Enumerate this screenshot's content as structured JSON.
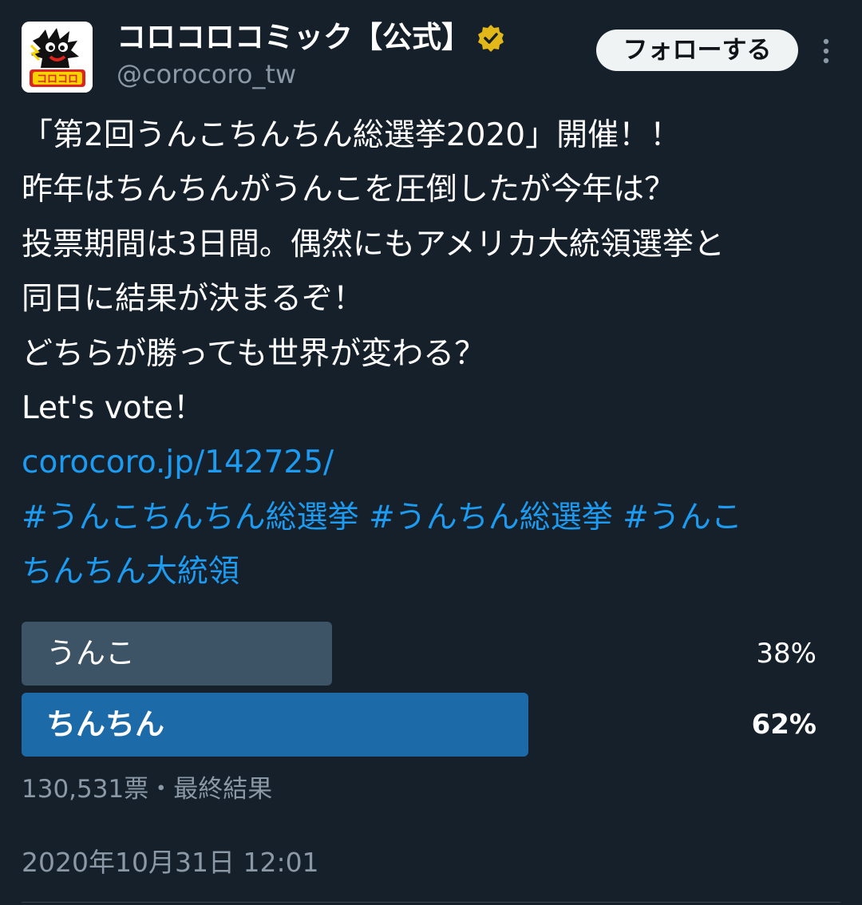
{
  "account": {
    "display_name": "コロコロコミック【公式】",
    "handle": "@corocoro_tw",
    "logo_text": "コロコロ"
  },
  "follow_button": {
    "label": "フォローする"
  },
  "tweet": {
    "lines": [
      "「第2回うんこちんちん総選挙2020」開催！！",
      "昨年はちんちんがうんこを圧倒したが今年は？",
      "投票期間は3日間。偶然にもアメリカ大統領選挙と",
      "同日に結果が決まるぞ！",
      "どちらが勝っても世界が変わる？",
      "Let's vote！"
    ],
    "link": "corocoro.jp/142725/",
    "hashtag_line1": "#うんこちんちん総選挙 #うんちん総選挙 #うんこ",
    "hashtag_line2": "ちんちん大統領"
  },
  "poll": {
    "options": [
      {
        "label": "うんこ",
        "percent_text": "38%",
        "fraction": 0.38
      },
      {
        "label": "ちんちん",
        "percent_text": "62%",
        "fraction": 0.62
      }
    ],
    "summary": "130,531票・最終結果"
  },
  "timestamp": "2020年10月31日 12:01",
  "colors": {
    "background": "#15202b",
    "link": "#1d9bf0",
    "secondary_text": "#8b98a5",
    "bar_loser": "#3d5466",
    "bar_winner": "#1d6aa8",
    "verified_badge": "#e2b719"
  }
}
